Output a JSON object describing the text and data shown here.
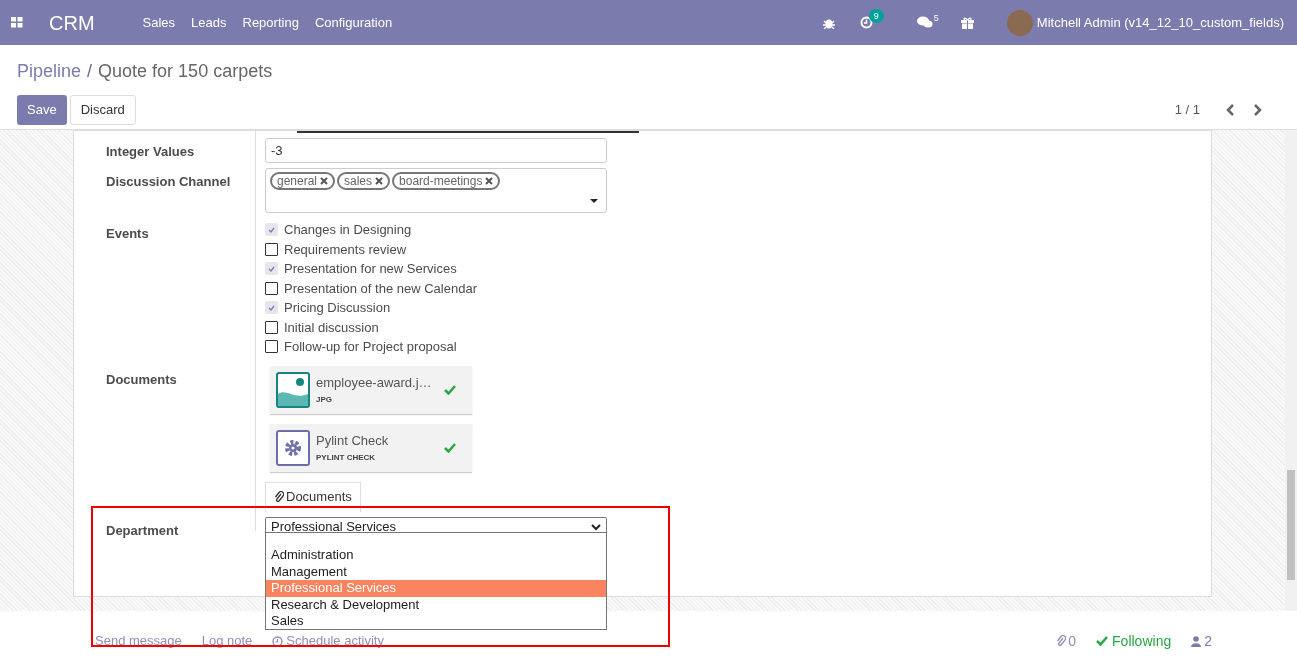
{
  "navbar": {
    "app": "CRM",
    "menus": [
      "Sales",
      "Leads",
      "Reporting",
      "Configuration"
    ],
    "activity_count": "9",
    "message_count": "5",
    "user": "Mitchell Admin (v14_12_10_custom_fields)"
  },
  "breadcrumb": {
    "parent": "Pipeline",
    "separator": "/",
    "current": "Quote for 150 carpets"
  },
  "buttons": {
    "save": "Save",
    "discard": "Discard"
  },
  "pager": "1 / 1",
  "form": {
    "integer_values": {
      "label": "Integer Values",
      "value": "-3"
    },
    "discussion_channel": {
      "label": "Discussion Channel",
      "tags": [
        "general",
        "sales",
        "board-meetings"
      ]
    },
    "events": {
      "label": "Events",
      "items": [
        {
          "label": "Changes in Designing",
          "checked": true
        },
        {
          "label": "Requirements review",
          "checked": false
        },
        {
          "label": "Presentation for new Services",
          "checked": true
        },
        {
          "label": "Presentation of the new Calendar",
          "checked": false
        },
        {
          "label": "Pricing Discussion",
          "checked": true
        },
        {
          "label": "Initial discussion",
          "checked": false
        },
        {
          "label": "Follow-up for Project proposal",
          "checked": false
        }
      ]
    },
    "documents": {
      "label": "Documents",
      "files": [
        {
          "kind": "image",
          "name": "employee-award.j…",
          "type": "JPG"
        },
        {
          "kind": "settings",
          "name": "Pylint Check",
          "type": "PYLINT CHECK"
        }
      ],
      "button": "Documents"
    },
    "department": {
      "label": "Department",
      "value": "Professional Services",
      "options": [
        {
          "label": "Administration",
          "selected": false
        },
        {
          "label": "Management",
          "selected": false
        },
        {
          "label": "Professional Services",
          "selected": true
        },
        {
          "label": "Research & Development",
          "selected": false
        },
        {
          "label": "Sales",
          "selected": false
        }
      ]
    }
  },
  "chatter": {
    "send_message": "Send message",
    "log_note": "Log note",
    "schedule_activity": "Schedule activity",
    "attachments": "0",
    "following": "Following",
    "followers": "2"
  }
}
